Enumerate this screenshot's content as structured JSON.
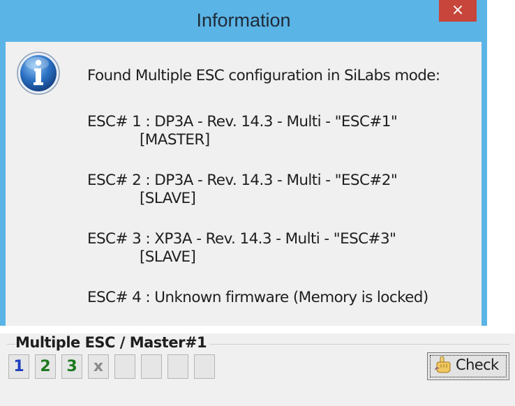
{
  "dialog": {
    "title": "Information",
    "close_label": "×",
    "message": {
      "intro": "Found Multiple ESC configuration in SiLabs mode:",
      "esc1_line": "ESC# 1 : DP3A - Rev. 14.3 - Multi - \"ESC#1\"",
      "esc1_role": "[MASTER]",
      "esc2_line": "ESC# 2 : DP3A - Rev. 14.3 - Multi - \"ESC#2\"",
      "esc2_role": "[SLAVE]",
      "esc3_line": "ESC# 3 : XP3A - Rev. 14.3 - Multi - \"ESC#3\"",
      "esc3_role": "[SLAVE]",
      "esc4_line": "ESC# 4 : Unknown firmware (Memory is locked)"
    }
  },
  "panel": {
    "group_title": "Multiple ESC / Master#1",
    "esc_buttons": [
      {
        "label": "1",
        "color": "#1f3fbf"
      },
      {
        "label": "2",
        "color": "#1e7a1e"
      },
      {
        "label": "3",
        "color": "#1e7a1e"
      },
      {
        "label": "x",
        "color": "#8a8a8a"
      },
      {
        "label": "",
        "color": "#000000"
      },
      {
        "label": "",
        "color": "#000000"
      },
      {
        "label": "",
        "color": "#000000"
      },
      {
        "label": "",
        "color": "#000000"
      }
    ],
    "check_label": "Check",
    "check_icon": "hand-pointer-icon"
  }
}
